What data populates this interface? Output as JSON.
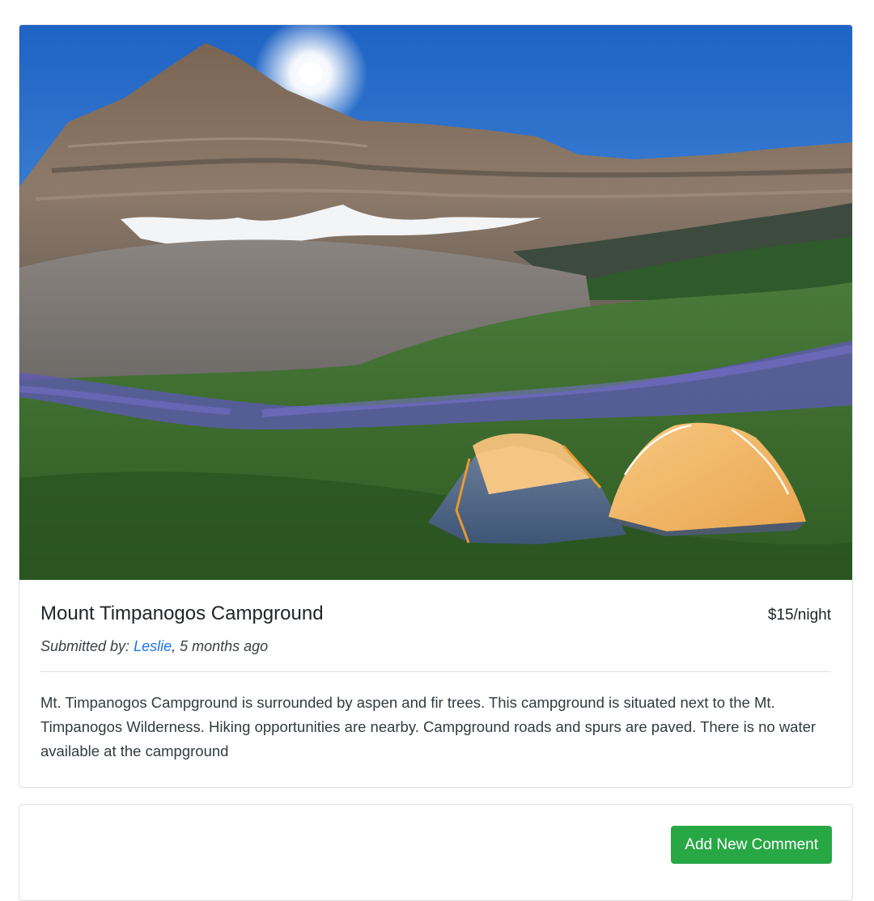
{
  "campground": {
    "name": "Mount Timpanogos Campground",
    "price": "$15/night",
    "submitted_prefix": "Submitted by: ",
    "author": "Leslie",
    "submitted_suffix": ", 5 months ago",
    "description": "Mt. Timpanogos Campground is surrounded by aspen and fir trees. This campground is situated next to the Mt. Timpanogos Wilderness. Hiking opportunities are nearby. Campground roads and spurs are paved. There is no water available at the campground"
  },
  "comments": {
    "add_button_label": "Add New Comment"
  },
  "colors": {
    "button_green": "#28a745",
    "link_blue": "#1a73e8"
  }
}
